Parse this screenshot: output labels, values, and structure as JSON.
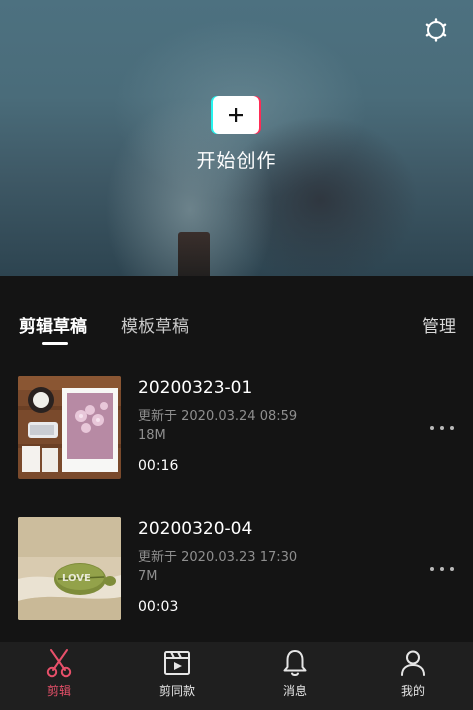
{
  "hero": {
    "create_label": "开始创作",
    "icons": {
      "settings": "settings-icon",
      "create": "plus-icon"
    }
  },
  "tabs": {
    "items": [
      {
        "label": "剪辑草稿",
        "active": true
      },
      {
        "label": "模板草稿",
        "active": false
      }
    ],
    "manage_label": "管理"
  },
  "drafts": [
    {
      "title": "20200323-01",
      "updated": "更新于 2020.03.24 08:59",
      "size": "18M",
      "duration": "00:16"
    },
    {
      "title": "20200320-04",
      "updated": "更新于 2020.03.23 17:30",
      "size": "7M",
      "duration": "00:03"
    }
  ],
  "bottom_nav": {
    "items": [
      {
        "label": "剪辑",
        "icon": "scissors-icon",
        "active": true
      },
      {
        "label": "剪同款",
        "icon": "clapperboard-icon",
        "active": false
      },
      {
        "label": "消息",
        "icon": "bell-icon",
        "active": false
      },
      {
        "label": "我的",
        "icon": "person-icon",
        "active": false
      }
    ]
  },
  "colors": {
    "accent": "#e8506a",
    "background": "#141414",
    "nav_background": "#1f1f1f"
  }
}
